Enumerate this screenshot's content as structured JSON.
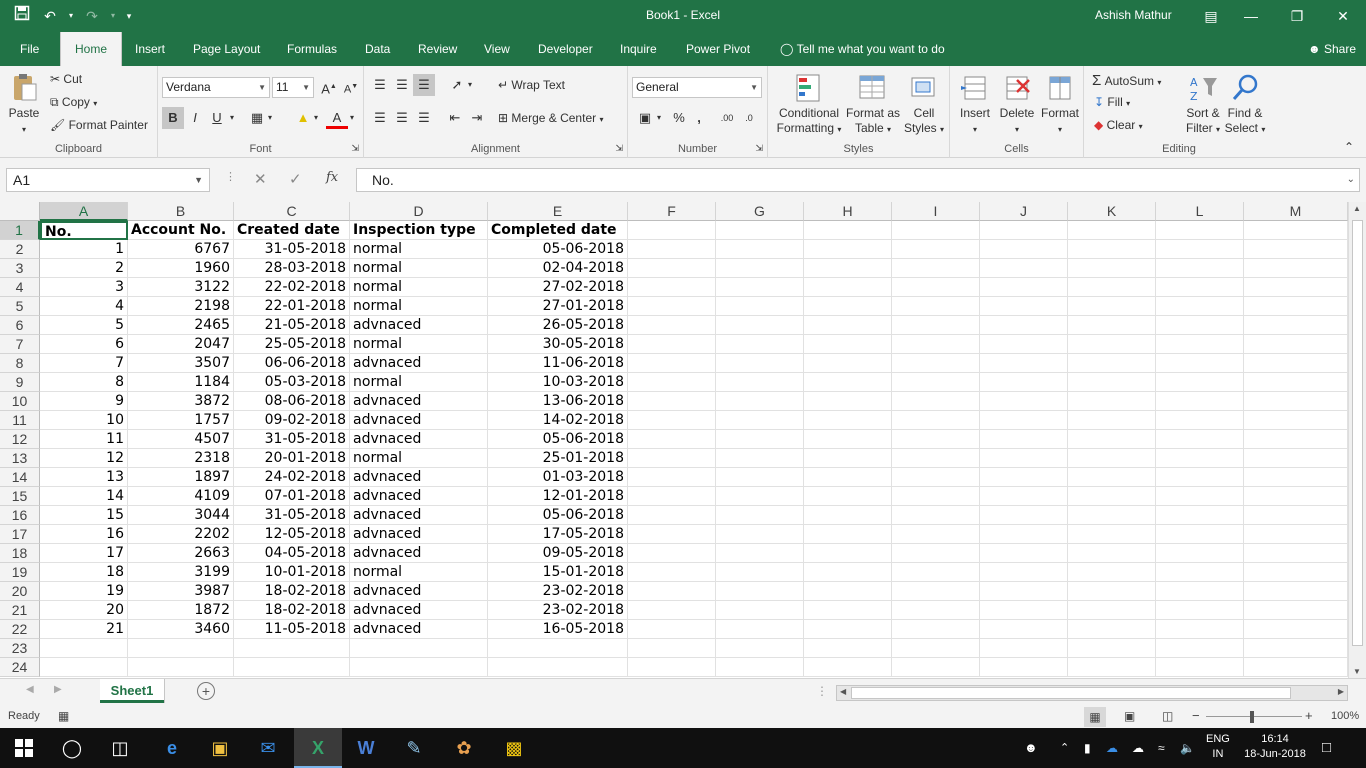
{
  "window": {
    "title": "Book1  -  Excel",
    "user": "Ashish Mathur",
    "brand_color": "#217346"
  },
  "tabs": [
    {
      "label": "File"
    },
    {
      "label": "Home",
      "active": true
    },
    {
      "label": "Insert"
    },
    {
      "label": "Page Layout"
    },
    {
      "label": "Formulas"
    },
    {
      "label": "Data"
    },
    {
      "label": "Review"
    },
    {
      "label": "View"
    },
    {
      "label": "Developer"
    },
    {
      "label": "Inquire"
    },
    {
      "label": "Power Pivot"
    }
  ],
  "tell_me": "Tell me what you want to do",
  "share": "Share",
  "ribbon": {
    "clipboard": {
      "label": "Clipboard",
      "paste": "Paste",
      "cut": "Cut",
      "copy": "Copy",
      "format_painter": "Format Painter"
    },
    "font": {
      "label": "Font",
      "font_name": "Verdana",
      "font_size": "11",
      "bold": "B",
      "italic": "I",
      "underline": "U"
    },
    "alignment": {
      "label": "Alignment",
      "wrap_text": "Wrap Text",
      "merge_center": "Merge & Center"
    },
    "number": {
      "label": "Number",
      "format": "General",
      "percent": "%",
      "comma": ","
    },
    "styles": {
      "label": "Styles",
      "conditional_1": "Conditional",
      "conditional_2": "Formatting",
      "format_table_1": "Format as",
      "format_table_2": "Table",
      "cell_styles_1": "Cell",
      "cell_styles_2": "Styles"
    },
    "cells": {
      "label": "Cells",
      "insert": "Insert",
      "delete": "Delete",
      "format": "Format"
    },
    "editing": {
      "label": "Editing",
      "autosum": "AutoSum",
      "fill": "Fill",
      "clear": "Clear",
      "sort_1": "Sort &",
      "sort_2": "Filter",
      "find_1": "Find &",
      "find_2": "Select"
    }
  },
  "formula_bar": {
    "name_box": "A1",
    "fx": "fx",
    "value": "No."
  },
  "sheet": {
    "columns": [
      "A",
      "B",
      "C",
      "D",
      "E",
      "F",
      "G",
      "H",
      "I",
      "J",
      "K",
      "L",
      "M"
    ],
    "row_numbers": [
      "1",
      "2",
      "3",
      "4",
      "5",
      "6",
      "7",
      "8",
      "9",
      "10",
      "11",
      "12",
      "13",
      "14",
      "15",
      "16",
      "17",
      "18",
      "19",
      "20",
      "21",
      "22",
      "23",
      "24"
    ],
    "header": [
      "No.",
      "Account No.",
      "Created date",
      "Inspection type",
      "Completed date"
    ],
    "rows": [
      [
        "1",
        "6767",
        "31-05-2018",
        "normal",
        "05-06-2018"
      ],
      [
        "2",
        "1960",
        "28-03-2018",
        "normal",
        "02-04-2018"
      ],
      [
        "3",
        "3122",
        "22-02-2018",
        "normal",
        "27-02-2018"
      ],
      [
        "4",
        "2198",
        "22-01-2018",
        "normal",
        "27-01-2018"
      ],
      [
        "5",
        "2465",
        "21-05-2018",
        "advnaced",
        "26-05-2018"
      ],
      [
        "6",
        "2047",
        "25-05-2018",
        "normal",
        "30-05-2018"
      ],
      [
        "7",
        "3507",
        "06-06-2018",
        "advnaced",
        "11-06-2018"
      ],
      [
        "8",
        "1184",
        "05-03-2018",
        "normal",
        "10-03-2018"
      ],
      [
        "9",
        "3872",
        "08-06-2018",
        "advnaced",
        "13-06-2018"
      ],
      [
        "10",
        "1757",
        "09-02-2018",
        "advnaced",
        "14-02-2018"
      ],
      [
        "11",
        "4507",
        "31-05-2018",
        "advnaced",
        "05-06-2018"
      ],
      [
        "12",
        "2318",
        "20-01-2018",
        "normal",
        "25-01-2018"
      ],
      [
        "13",
        "1897",
        "24-02-2018",
        "advnaced",
        "01-03-2018"
      ],
      [
        "14",
        "4109",
        "07-01-2018",
        "advnaced",
        "12-01-2018"
      ],
      [
        "15",
        "3044",
        "31-05-2018",
        "advnaced",
        "05-06-2018"
      ],
      [
        "16",
        "2202",
        "12-05-2018",
        "advnaced",
        "17-05-2018"
      ],
      [
        "17",
        "2663",
        "04-05-2018",
        "advnaced",
        "09-05-2018"
      ],
      [
        "18",
        "3199",
        "10-01-2018",
        "normal",
        "15-01-2018"
      ],
      [
        "19",
        "3987",
        "18-02-2018",
        "advnaced",
        "23-02-2018"
      ],
      [
        "20",
        "1872",
        "18-02-2018",
        "advnaced",
        "23-02-2018"
      ],
      [
        "21",
        "3460",
        "11-05-2018",
        "advnaced",
        "16-05-2018"
      ]
    ],
    "tab_name": "Sheet1"
  },
  "status": {
    "ready": "Ready",
    "zoom": "100%"
  },
  "taskbar": {
    "lang_1": "ENG",
    "lang_2": "IN",
    "time": "16:14",
    "date": "18-Jun-2018"
  }
}
